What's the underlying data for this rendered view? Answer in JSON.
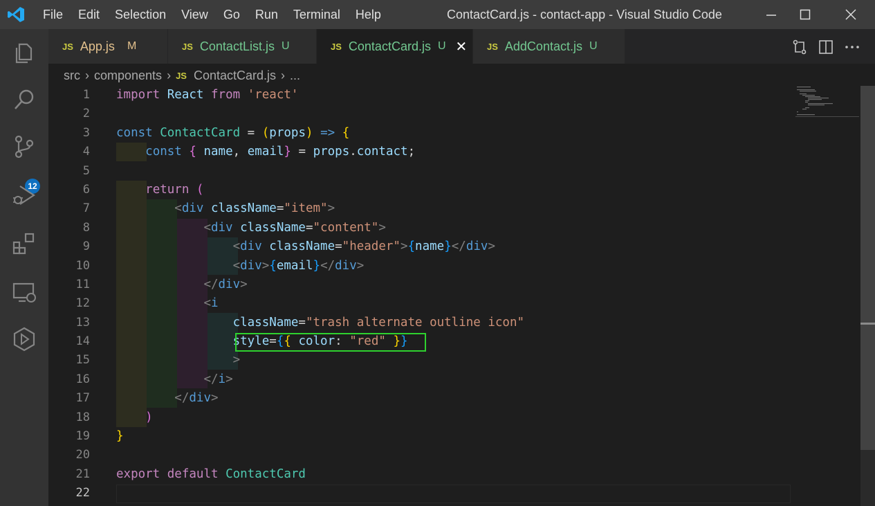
{
  "window": {
    "title": "ContactCard.js - contact-app - Visual Studio Code",
    "menu": [
      "File",
      "Edit",
      "Selection",
      "View",
      "Go",
      "Run",
      "Terminal",
      "Help"
    ]
  },
  "activity_bar": {
    "icons": [
      "explorer-icon",
      "search-icon",
      "source-control-icon",
      "run-debug-icon",
      "extensions-icon",
      "remote-explorer-icon",
      "deploy-icon"
    ],
    "source_control_badge": "12"
  },
  "tabs": [
    {
      "label": "App.js",
      "status": "M",
      "label_color": "#e2c08d",
      "active": false
    },
    {
      "label": "ContactList.js",
      "status": "U",
      "label_color": "#73c991",
      "active": false
    },
    {
      "label": "ContactCard.js",
      "status": "U",
      "label_color": "#73c991",
      "active": true
    },
    {
      "label": "AddContact.js",
      "status": "U",
      "label_color": "#73c991",
      "active": false
    }
  ],
  "breadcrumb": {
    "segments": [
      "src",
      "components",
      "ContactCard.js",
      "..."
    ],
    "file_icon": "JS"
  },
  "editor": {
    "line_numbers": [
      "1",
      "2",
      "3",
      "4",
      "5",
      "6",
      "7",
      "8",
      "9",
      "10",
      "11",
      "12",
      "13",
      "14",
      "15",
      "16",
      "17",
      "18",
      "19",
      "20",
      "21",
      "22"
    ],
    "current_line": "22",
    "highlighted_line": "14"
  },
  "colors": {
    "highlight_box": "#2ed12e",
    "modified": "#e2c08d",
    "untracked": "#73c991"
  }
}
